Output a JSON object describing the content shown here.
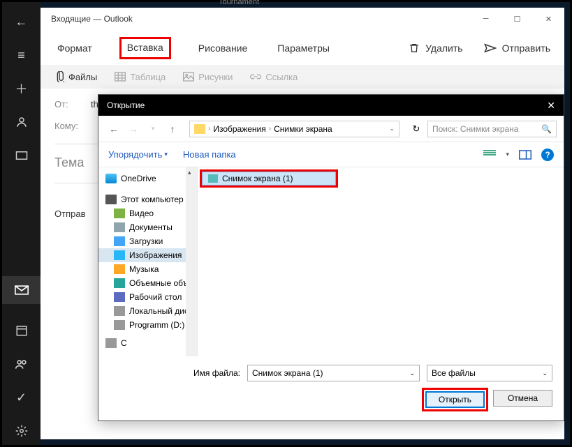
{
  "top_app": "Tournament",
  "window": {
    "title": "Входящие — Outlook"
  },
  "tabs": {
    "format": "Формат",
    "insert": "Вставка",
    "draw": "Рисование",
    "options": "Параметры",
    "delete": "Удалить",
    "send": "Отправить"
  },
  "toolbar": {
    "files": "Файлы",
    "table": "Таблица",
    "pictures": "Рисунки",
    "link": "Ссылка"
  },
  "compose": {
    "from_label": "От:",
    "from_value": "th",
    "to_label": "Кому:",
    "subject_label": "Тема",
    "body_prefix": "Отправ"
  },
  "dialog": {
    "title": "Открытие",
    "breadcrumb": {
      "p1": "Изображения",
      "p2": "Снимки экрана"
    },
    "search_placeholder": "Поиск: Снимки экрана",
    "organize": "Упорядочить",
    "new_folder": "Новая папка",
    "tree": {
      "onedrive": "OneDrive",
      "this_pc": "Этот компьютер",
      "video": "Видео",
      "documents": "Документы",
      "downloads": "Загрузки",
      "pictures": "Изображения",
      "music": "Музыка",
      "objects3d": "Объемные объекты",
      "desktop": "Рабочий стол",
      "local_disk": "Локальный диск",
      "programm": "Programm (D:)",
      "drive_more": "С"
    },
    "file": "Снимок экрана (1)",
    "filename_label": "Имя файла:",
    "filename_value": "Снимок экрана (1)",
    "filter": "Все файлы",
    "open": "Открыть",
    "cancel": "Отмена"
  }
}
